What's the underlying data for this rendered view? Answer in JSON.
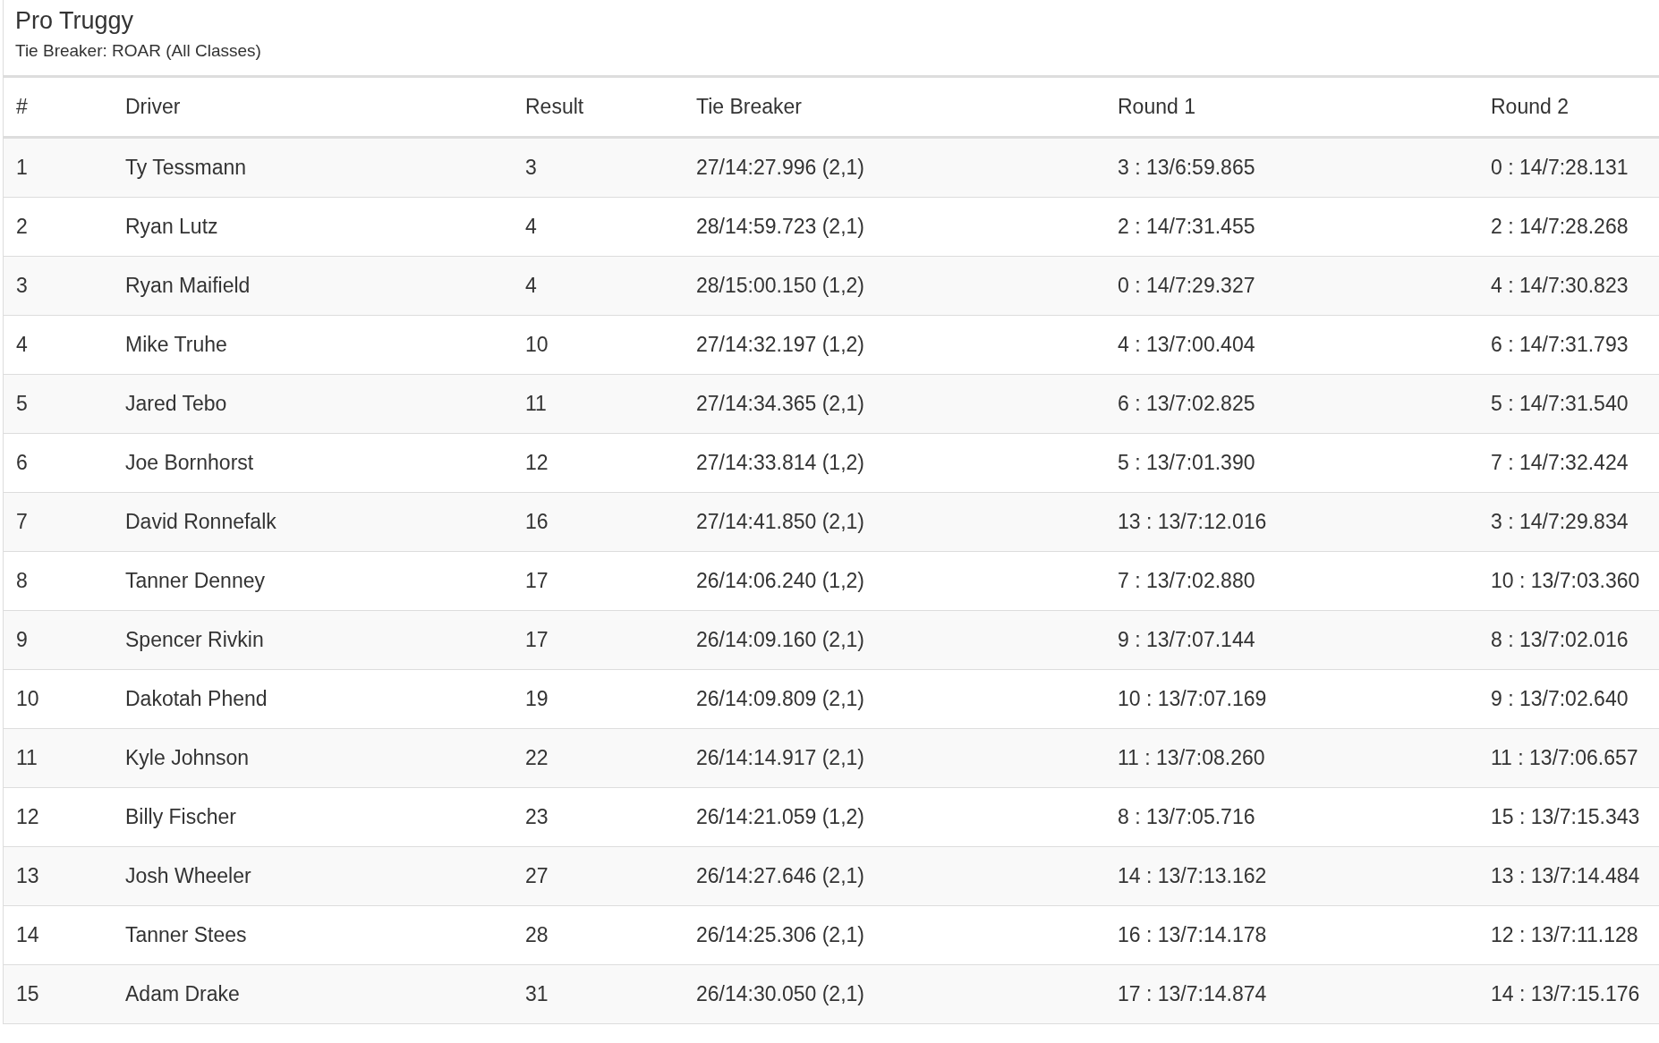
{
  "title": "Pro Truggy",
  "subtitle": "Tie Breaker: ROAR (All Classes)",
  "table": {
    "columns": [
      "#",
      "Driver",
      "Result",
      "Tie Breaker",
      "Round 1",
      "Round 2"
    ],
    "rows": [
      [
        "1",
        "Ty Tessmann",
        "3",
        "27/14:27.996 (2,1)",
        "3 : 13/6:59.865",
        "0 : 14/7:28.131"
      ],
      [
        "2",
        "Ryan Lutz",
        "4",
        "28/14:59.723 (2,1)",
        "2 : 14/7:31.455",
        "2 : 14/7:28.268"
      ],
      [
        "3",
        "Ryan Maifield",
        "4",
        "28/15:00.150 (1,2)",
        "0 : 14/7:29.327",
        "4 : 14/7:30.823"
      ],
      [
        "4",
        "Mike Truhe",
        "10",
        "27/14:32.197 (1,2)",
        "4 : 13/7:00.404",
        "6 : 14/7:31.793"
      ],
      [
        "5",
        "Jared Tebo",
        "11",
        "27/14:34.365 (2,1)",
        "6 : 13/7:02.825",
        "5 : 14/7:31.540"
      ],
      [
        "6",
        "Joe Bornhorst",
        "12",
        "27/14:33.814 (1,2)",
        "5 : 13/7:01.390",
        "7 : 14/7:32.424"
      ],
      [
        "7",
        "David Ronnefalk",
        "16",
        "27/14:41.850 (2,1)",
        "13 : 13/7:12.016",
        "3 : 14/7:29.834"
      ],
      [
        "8",
        "Tanner Denney",
        "17",
        "26/14:06.240 (1,2)",
        "7 : 13/7:02.880",
        "10 : 13/7:03.360"
      ],
      [
        "9",
        "Spencer Rivkin",
        "17",
        "26/14:09.160 (2,1)",
        "9 : 13/7:07.144",
        "8 : 13/7:02.016"
      ],
      [
        "10",
        "Dakotah Phend",
        "19",
        "26/14:09.809 (2,1)",
        "10 : 13/7:07.169",
        "9 : 13/7:02.640"
      ],
      [
        "11",
        "Kyle Johnson",
        "22",
        "26/14:14.917 (2,1)",
        "11 : 13/7:08.260",
        "11 : 13/7:06.657"
      ],
      [
        "12",
        "Billy Fischer",
        "23",
        "26/14:21.059 (1,2)",
        "8 : 13/7:05.716",
        "15 : 13/7:15.343"
      ],
      [
        "13",
        "Josh Wheeler",
        "27",
        "26/14:27.646 (2,1)",
        "14 : 13/7:13.162",
        "13 : 13/7:14.484"
      ],
      [
        "14",
        "Tanner Stees",
        "28",
        "26/14:25.306 (2,1)",
        "16 : 13/7:14.178",
        "12 : 13/7:11.128"
      ],
      [
        "15",
        "Adam Drake",
        "31",
        "26/14:30.050 (2,1)",
        "17 : 13/7:14.874",
        "14 : 13/7:15.176"
      ]
    ]
  }
}
